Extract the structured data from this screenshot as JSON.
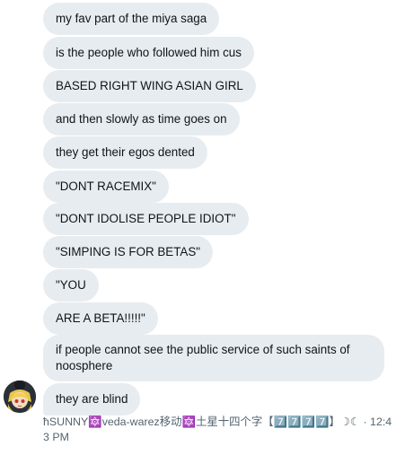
{
  "messages": [
    {
      "text": "my fav part of the miya saga"
    },
    {
      "text": "is the people who followed him cus"
    },
    {
      "text": "BASED RIGHT WING ASIAN GIRL"
    },
    {
      "text": "and then slowly as time goes on"
    },
    {
      "text": "they get their egos dented"
    },
    {
      "text": "\"DONT RACEMIX\""
    },
    {
      "text": "\"DONT IDOLISE PEOPLE IDIOT\""
    },
    {
      "text": "\"SIMPING IS FOR BETAS\""
    },
    {
      "text": "\"YOU"
    },
    {
      "text": "ARE A BETA!!!!!\""
    },
    {
      "text": "if people cannot see the public service of such saints of noosphere"
    },
    {
      "text": "they are blind"
    }
  ],
  "sender": {
    "display_name": "ħSUNNY🔯veda-warez移动🔯土星十四个字【7️⃣7️⃣7️⃣7️⃣】☽☾",
    "separator": "·",
    "timestamp": "12:43 PM"
  },
  "avatar": {
    "icon": "avatar-anime-girl"
  },
  "colors": {
    "bubble_bg": "#e7ecf0",
    "text": "#0f1419",
    "meta": "#536471"
  }
}
